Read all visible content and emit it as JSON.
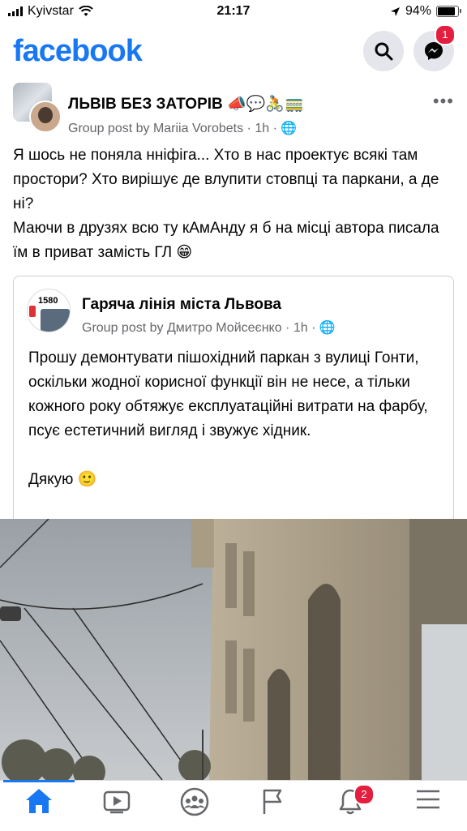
{
  "status": {
    "carrier": "Kyivstar",
    "time": "21:17",
    "battery": "94%",
    "battery_level": 0.94
  },
  "header": {
    "logo": "facebook",
    "messenger_badge": "1",
    "icons": [
      "search-icon",
      "messenger-icon"
    ]
  },
  "post": {
    "group_name": "ЛЬВІВ БЕЗ ЗАТОРІВ 📣💬🚴🚃",
    "subtitle": "Group post by Mariia Vorobets · 1h · 🌐",
    "paragraphs": [
      "Я шось не поняла нніфіга... Хто в нас проектує всякі там простори? Хто вирішує де влупити стовпці та паркани, а де ні?",
      "Маючи в друзях всю ту кАмАнду я б на місці автора писала їм в приват замість ГЛ 😁"
    ]
  },
  "shared_post": {
    "avatar_text": "1580",
    "group_name": "Гаряча лінія міста Львова",
    "subtitle": "Group post by Дмитро Мойсеєнко · 1h · 🌐",
    "paragraphs": [
      "Прошу демонтувати пішохідний паркан з вулиці Гонти, оскільки жодної корисної функції він не несе, а тільки кожного року обтяжує експлуатаційні витрати на фарбу, псує естетичний вигляд і звужує хідник.",
      "",
      "Дякую 🙂"
    ]
  },
  "tabbar": {
    "tabs": [
      "home-icon",
      "video-icon",
      "groups-icon",
      "pages-flag-icon",
      "notifications-icon",
      "menu-icon"
    ],
    "notifications_badge": "2",
    "active": "home"
  },
  "colors": {
    "brand": "#1877f2",
    "badge": "#e41e3f",
    "secondary_text": "#65676b"
  }
}
